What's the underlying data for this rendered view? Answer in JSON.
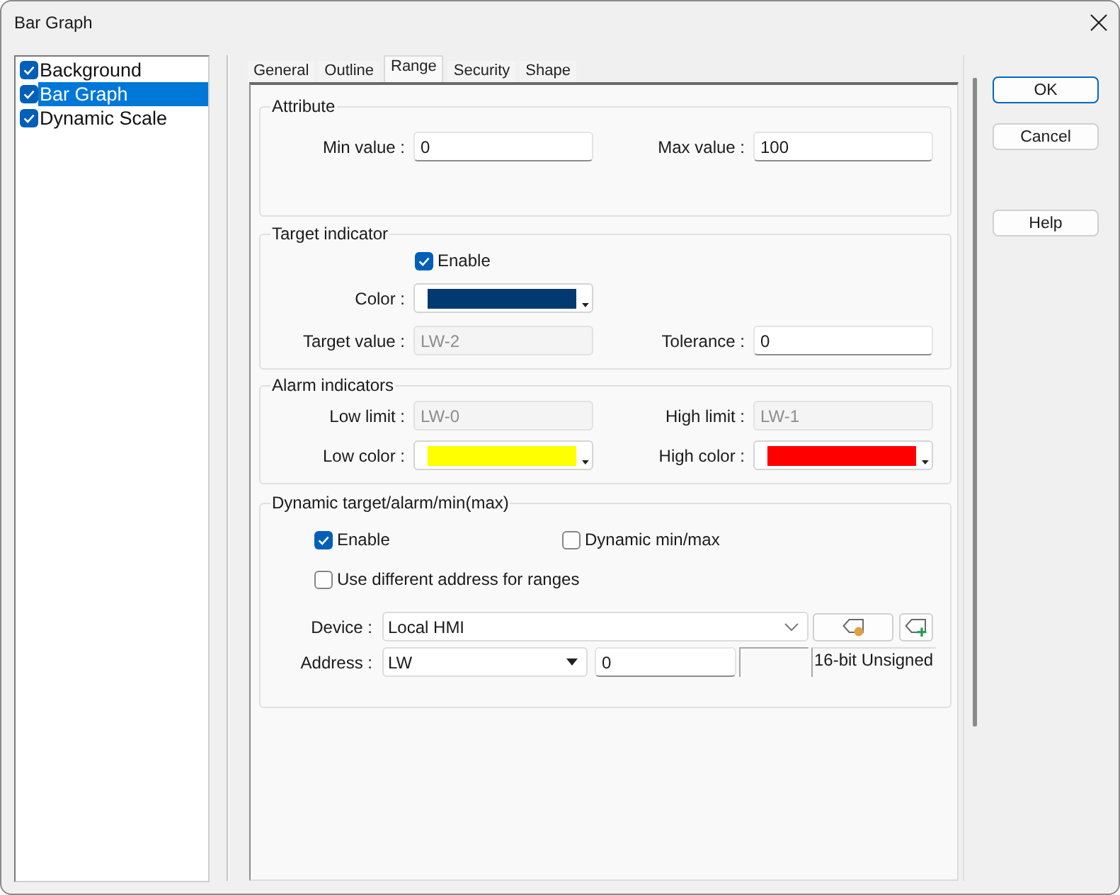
{
  "window": {
    "title": "Bar Graph"
  },
  "object_list": [
    {
      "label": "Background",
      "checked": true,
      "selected": false
    },
    {
      "label": "Bar Graph",
      "checked": true,
      "selected": true
    },
    {
      "label": "Dynamic Scale",
      "checked": true,
      "selected": false
    }
  ],
  "tabs": [
    {
      "label": "General",
      "selected": false
    },
    {
      "label": "Outline",
      "selected": false
    },
    {
      "label": "Range",
      "selected": true
    },
    {
      "label": "Security",
      "selected": false
    },
    {
      "label": "Shape",
      "selected": false
    }
  ],
  "attribute": {
    "title": "Attribute",
    "fields": [
      {
        "label": "Min value :",
        "value": "0",
        "disabled": false
      },
      {
        "label": "Max value :",
        "value": "100",
        "disabled": false
      }
    ]
  },
  "target_indicator": {
    "title": "Target indicator",
    "enable": {
      "label": "Enable",
      "checked": true
    },
    "color": {
      "label": "Color :",
      "color": "#003a70"
    },
    "fields": [
      {
        "label": "Target value :",
        "value": "LW-2",
        "disabled": true
      },
      {
        "label": "Tolerance :",
        "value": "0",
        "disabled": false
      }
    ]
  },
  "alarm_indicators": {
    "title": "Alarm indicators",
    "fields": [
      {
        "label": "Low limit :",
        "value": "LW-0",
        "disabled": true
      },
      {
        "label": "High limit :",
        "value": "LW-1",
        "disabled": true
      }
    ],
    "colors": [
      {
        "label": "Low color :",
        "color": "#ffff00"
      },
      {
        "label": "High color :",
        "color": "#ff0000"
      }
    ]
  },
  "dynamic": {
    "title": "Dynamic target/alarm/min(max)",
    "options": [
      {
        "label": "Enable",
        "checked": true
      },
      {
        "label": "Dynamic min/max",
        "checked": false
      },
      {
        "label": "Use different address for ranges",
        "checked": false
      }
    ],
    "device": {
      "label": "Device :",
      "value": "Local HMI"
    },
    "address": {
      "label": "Address :",
      "type": "LW",
      "value": "0",
      "data_type": "16-bit Unsigned"
    }
  },
  "buttons": [
    {
      "label": "OK",
      "focused": true
    },
    {
      "label": "Cancel",
      "focused": false
    },
    {
      "label": "Help",
      "focused": false
    }
  ]
}
